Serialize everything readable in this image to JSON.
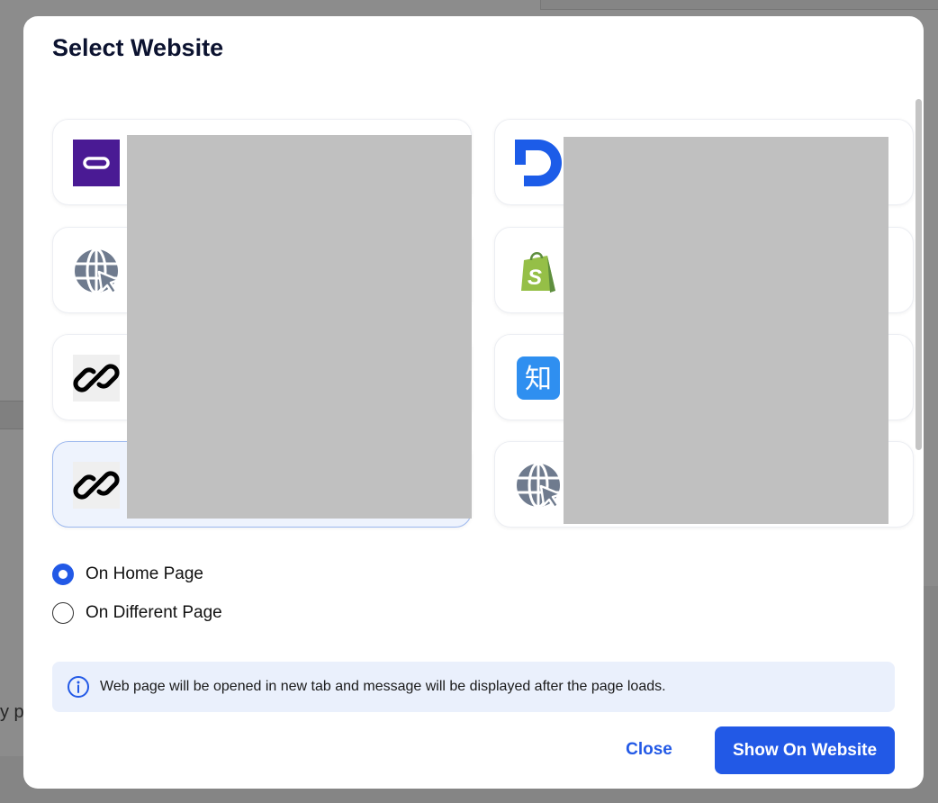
{
  "modal": {
    "title": "Select Website",
    "websites": [
      {
        "name": "",
        "icon": "purple-oval-logo-icon",
        "selected": false
      },
      {
        "name": "",
        "icon": "blue-d-logo-icon",
        "selected": false
      },
      {
        "name": "",
        "icon": "globe-cursor-icon",
        "selected": false
      },
      {
        "name": "",
        "icon": "shopify-bag-icon",
        "selected": false
      },
      {
        "name": "",
        "icon": "link-icon",
        "selected": false
      },
      {
        "name": "",
        "icon": "zhihu-logo-icon",
        "selected": false
      },
      {
        "name": "",
        "icon": "link-icon",
        "selected": true
      },
      {
        "name": "",
        "icon": "globe-cursor-icon",
        "selected": false
      }
    ],
    "page_options": [
      {
        "label": "On Home Page",
        "checked": true
      },
      {
        "label": "On Different Page",
        "checked": false
      }
    ],
    "info_text": "Web page will be opened in new tab and message will be displayed after the page loads.",
    "close_label": "Close",
    "submit_label": "Show On Website"
  },
  "background": {
    "partial_text": "y p"
  },
  "colors": {
    "accent": "#2259e6",
    "info_bg": "#eaf0fc",
    "selected_card_bg": "#eef3fd",
    "redaction": "#c0c0c0"
  },
  "zhihu_glyph": "知"
}
